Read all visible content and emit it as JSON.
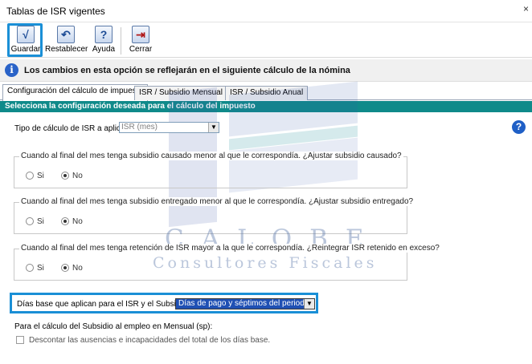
{
  "window": {
    "title": "Tablas de ISR vigentes",
    "close_glyph": "×"
  },
  "toolbar": {
    "guardar": {
      "label": "Guardar",
      "icon": "check-icon",
      "glyph": "√"
    },
    "restablecer": {
      "label": "Restablecer",
      "icon": "undo-icon",
      "glyph": "↶"
    },
    "ayuda": {
      "label": "Ayuda",
      "icon": "help-icon",
      "glyph": "?"
    },
    "cerrar": {
      "label": "Cerrar",
      "icon": "exit-icon",
      "glyph": "⇥"
    }
  },
  "info": {
    "icon": "info-icon",
    "glyph": "i",
    "message": "Los cambios en esta opción se reflejarán en el siguiente cálculo de la nómina"
  },
  "tabs": [
    {
      "label": "Configuración del cálculo de impuesto",
      "active": true
    },
    {
      "label": "ISR / Subsidio Mensual",
      "active": false
    },
    {
      "label": "ISR / Subsidio Anual",
      "active": false
    }
  ],
  "section": {
    "title": "Selecciona la configuración deseada para el cálculo del impuesto"
  },
  "tipo_calculo": {
    "label": "Tipo de cálculo de ISR a aplicar:",
    "value": "ISR (mes)",
    "arrow": "▼"
  },
  "help_glyph": "?",
  "groups": [
    {
      "legend": "Cuando al final del mes tenga subsidio causado menor al que le correspondía. ¿Ajustar subsidio causado?",
      "options": [
        "Si",
        "No"
      ],
      "selected": "No"
    },
    {
      "legend": "Cuando al final del mes tenga subsidio entregado menor al que le correspondía. ¿Ajustar subsidio entregado?",
      "options": [
        "Si",
        "No"
      ],
      "selected": "No"
    },
    {
      "legend": "Cuando al final del mes tenga retención de ISR mayor a la que le correspondía. ¿Reintegrar ISR retenido en exceso?",
      "options": [
        "Si",
        "No"
      ],
      "selected": "No"
    }
  ],
  "dias_base": {
    "label": "Días base que aplican para el  ISR y el Subsidio:",
    "value": "Días de pago y séptimos del periodo",
    "arrow": "▼"
  },
  "subsidio_mensual": {
    "label": "Para el cálculo del Subsidio al empleo en Mensual (sp):"
  },
  "descontar": {
    "label": "Descontar las ausencias e incapacidades del total de los días base.",
    "checked": false
  },
  "watermark": {
    "word": "CALOBE",
    "sub": "Consultores Fiscales"
  },
  "colors": {
    "section_bg": "#0f8a8a",
    "highlight": "#1a8fd6",
    "combo_selected": "#1f50b4"
  }
}
